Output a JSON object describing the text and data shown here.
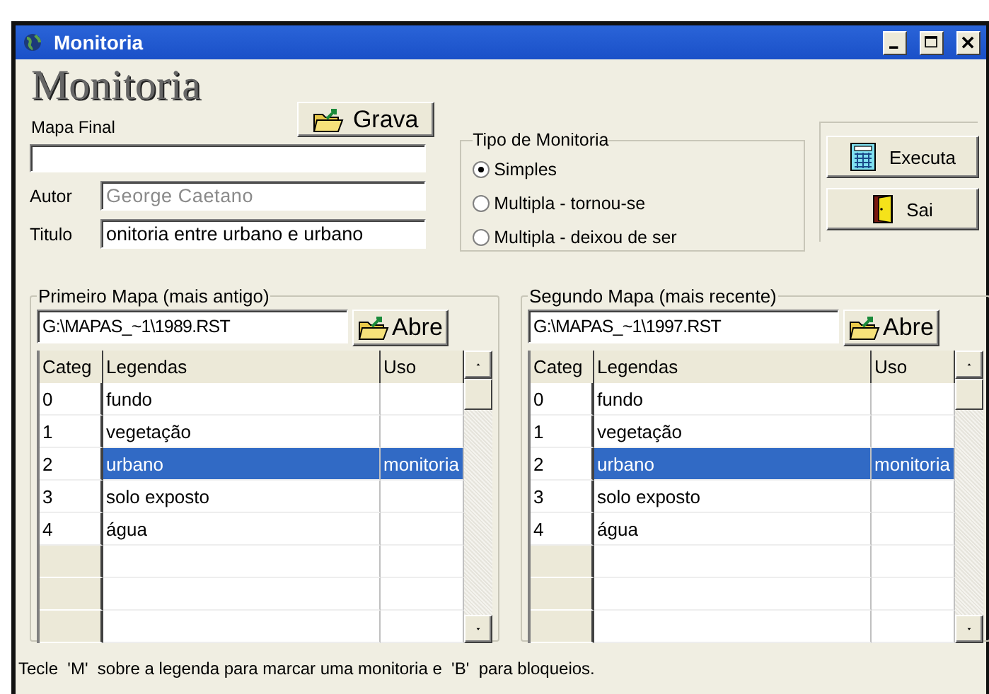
{
  "window": {
    "title": "Monitoria"
  },
  "header": {
    "title": "Monitoria",
    "output_label": "Mapa Final",
    "save_button": "Grava"
  },
  "fields": [
    {
      "label": "Autor",
      "value": "George Caetano",
      "disabled": true
    },
    {
      "label": "Titulo",
      "value": "onitoria entre urbano e urbano",
      "disabled": false
    }
  ],
  "monitoring_type": {
    "label": "Tipo de Monitoria",
    "options": [
      {
        "label": "Simples",
        "selected": true
      },
      {
        "label": "Multipla - tornou-se",
        "selected": false
      },
      {
        "label": "Multipla - deixou de ser",
        "selected": false
      }
    ]
  },
  "actions": [
    {
      "label": "Executa",
      "kind": "run"
    },
    {
      "label": "Sai",
      "kind": "exit"
    }
  ],
  "maps": [
    {
      "legend": "Primeiro Mapa (mais antigo)",
      "path": "G:\\MAPAS_~1\\1989.RST",
      "open_button": "Abre",
      "columns": [
        "Categ",
        "Legendas",
        "Uso"
      ],
      "rows": [
        {
          "categ": "0",
          "legend": "fundo",
          "selected": false
        },
        {
          "categ": "1",
          "legend": "vegetação",
          "selected": false
        },
        {
          "categ": "2",
          "legend": "urbano",
          "uso": "monitoria",
          "selected": true
        },
        {
          "categ": "3",
          "legend": "solo exposto",
          "selected": false
        },
        {
          "categ": "4",
          "legend": "água",
          "selected": false
        }
      ]
    },
    {
      "legend": "Segundo Mapa (mais recente)",
      "path": "G:\\MAPAS_~1\\1997.RST",
      "open_button": "Abre",
      "columns": [
        "Categ",
        "Legendas",
        "Uso"
      ],
      "rows": [
        {
          "categ": "0",
          "legend": "fundo",
          "selected": false
        },
        {
          "categ": "1",
          "legend": "vegetação",
          "selected": false
        },
        {
          "categ": "2",
          "legend": "urbano",
          "uso": "monitoria",
          "selected": true
        },
        {
          "categ": "3",
          "legend": "solo exposto",
          "selected": false
        },
        {
          "categ": "4",
          "legend": "água",
          "selected": false
        }
      ]
    }
  ],
  "status_bar": "Tecle  'M'  sobre a legenda para marcar uma monitoria e  'B'  para bloqueios."
}
